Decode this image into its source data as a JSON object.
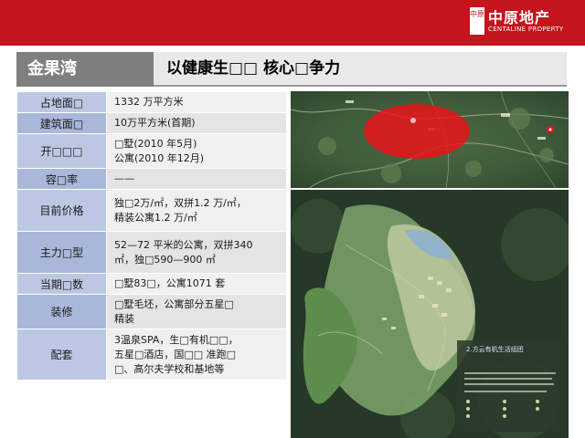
{
  "header": {
    "logo_seal": "中原",
    "logo_cn": "中原地产",
    "logo_en": "CENTALINE PROPERTY"
  },
  "title": {
    "project": "金果湾",
    "headline": "以健康生□□ 核心□争力"
  },
  "table": {
    "rows": [
      {
        "label": "占地面□",
        "lines": [
          "1332 万平方米"
        ]
      },
      {
        "label": "建筑面□",
        "lines": [
          "10万平方米(首期)"
        ]
      },
      {
        "label": "开□□□",
        "lines": [
          "□墅(2010 年5月)",
          "公寓(2010 年12月)"
        ]
      },
      {
        "label": "容□率",
        "lines": [
          "——"
        ]
      },
      {
        "label": "目前价格",
        "lines": [
          "独□2万/㎡，双拼1.2 万/㎡，",
          "精装公寓1.2 万/㎡"
        ]
      },
      {
        "label": "主力□型",
        "lines": [
          "52—72 平米的公寓，双拼340",
          "㎡，独□590—900 ㎡"
        ]
      },
      {
        "label": "当期□数",
        "lines": [
          "□墅83□，公寓1071 套"
        ]
      },
      {
        "label": "装修",
        "lines": [
          "□墅毛坯，公寓部分五星□",
          "精装"
        ]
      },
      {
        "label": "配套",
        "lines": [
          "3温泉SPA，生□有机□□，",
          "五星□酒店，国□□ 准跑□",
          "□、高尔夫学校和基地等"
        ]
      }
    ]
  },
  "maps": {
    "plan_caption": "2.方云有机生活组团"
  },
  "colors": {
    "brand_red": "#c4141c",
    "label_blue": "#bcc8e3",
    "title_grey": "#7f7f7f"
  }
}
